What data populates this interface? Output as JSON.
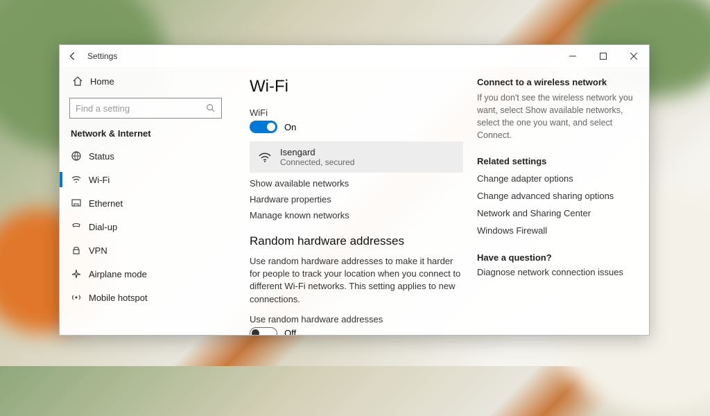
{
  "titlebar": {
    "title": "Settings"
  },
  "sidebar": {
    "home": "Home",
    "search_placeholder": "Find a setting",
    "category": "Network & Internet",
    "items": [
      {
        "label": "Status"
      },
      {
        "label": "Wi-Fi"
      },
      {
        "label": "Ethernet"
      },
      {
        "label": "Dial-up"
      },
      {
        "label": "VPN"
      },
      {
        "label": "Airplane mode"
      },
      {
        "label": "Mobile hotspot"
      }
    ]
  },
  "main": {
    "title": "Wi-Fi",
    "wifi_label": "WiFi",
    "wifi_toggle_state": "On",
    "network": {
      "ssid": "Isengard",
      "status": "Connected, secured"
    },
    "links": {
      "show_available": "Show available networks",
      "hw_props": "Hardware properties",
      "manage_known": "Manage known networks"
    },
    "random_hw": {
      "heading": "Random hardware addresses",
      "body": "Use random hardware addresses to make it harder for people to track your location when you connect to different Wi-Fi networks. This setting applies to new connections.",
      "toggle_label": "Use random hardware addresses",
      "toggle_state": "Off"
    }
  },
  "aside": {
    "connect": {
      "heading": "Connect to a wireless network",
      "body": "If you don't see the wireless network you want, select Show available networks, select the one you want, and select Connect."
    },
    "related_heading": "Related settings",
    "related_links": [
      "Change adapter options",
      "Change advanced sharing options",
      "Network and Sharing Center",
      "Windows Firewall"
    ],
    "question_heading": "Have a question?",
    "question_link": "Diagnose network connection issues"
  }
}
